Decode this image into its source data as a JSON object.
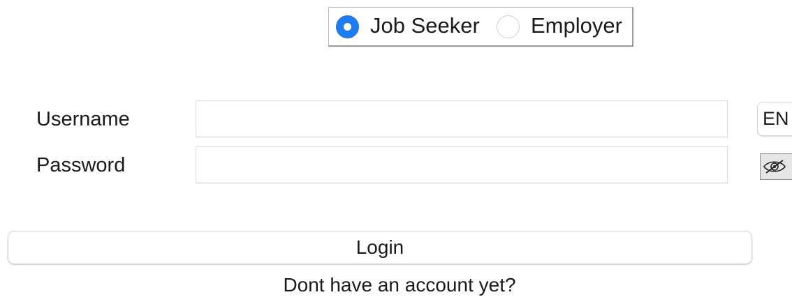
{
  "role_selector": {
    "options": [
      {
        "label": "Job Seeker",
        "selected": true
      },
      {
        "label": "Employer",
        "selected": false
      }
    ]
  },
  "form": {
    "username_label": "Username",
    "username_value": "",
    "password_label": "Password",
    "password_value": ""
  },
  "language_button": {
    "label": "EN"
  },
  "password_toggle": {
    "icon": "eye-slash-icon"
  },
  "login_button": {
    "label": "Login"
  },
  "signup_prompt": {
    "text": "Dont have an account yet?"
  },
  "colors": {
    "accent": "#1e7cf2",
    "background": "#ffffff"
  }
}
